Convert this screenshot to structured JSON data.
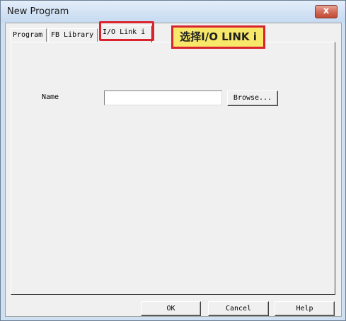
{
  "window": {
    "title": "New Program",
    "close_glyph": "x"
  },
  "tabs": [
    {
      "label": "Program"
    },
    {
      "label": "FB Library"
    },
    {
      "label": "I/O Link i"
    }
  ],
  "callout": {
    "text": "选择I/O LINK i"
  },
  "form": {
    "name_label": "Name",
    "name_value": "",
    "browse_label": "Browse..."
  },
  "buttons": {
    "ok": "OK",
    "cancel": "Cancel",
    "help": "Help"
  },
  "colors": {
    "highlight_border": "#d9232e",
    "callout_bg": "#f7e869",
    "titlebar": "#d2e2f4"
  }
}
